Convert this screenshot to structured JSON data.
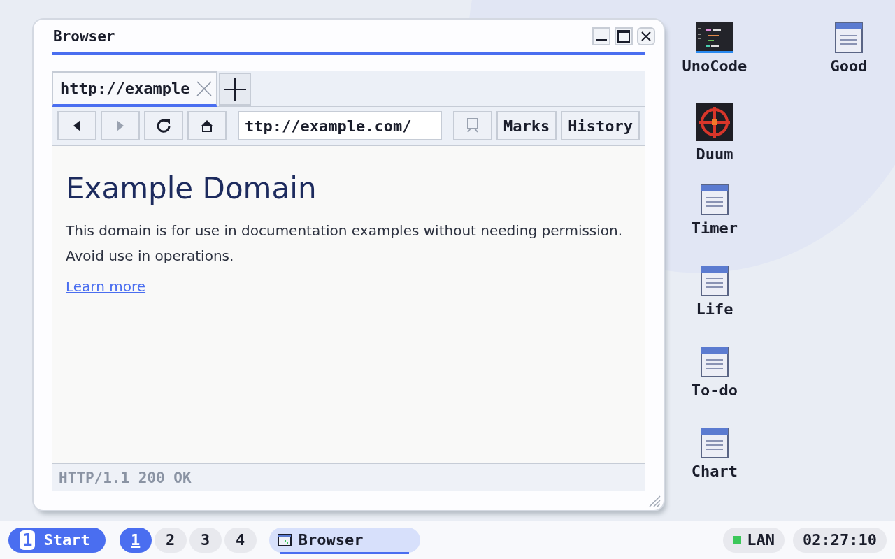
{
  "window": {
    "title": "Browser"
  },
  "tabs": [
    {
      "label": "http://example",
      "selected": true
    }
  ],
  "toolbar": {
    "nav": [
      {
        "kind": "back",
        "disabled": false
      },
      {
        "kind": "forward",
        "disabled": true
      },
      {
        "kind": "reload",
        "disabled": false
      },
      {
        "kind": "home",
        "disabled": false
      }
    ],
    "address": "ttp://example.com/",
    "bookmark_disabled": true,
    "buttons": [
      "Marks",
      "History"
    ]
  },
  "page": {
    "heading": "Example Domain",
    "paragraph": "This domain is for use in documentation examples without needing permission. Avoid use in operations.",
    "link": "Learn more"
  },
  "status_bar": "HTTP/1.1 200 OK",
  "desktop_icons": [
    {
      "label": "UnoCode",
      "kind": "code"
    },
    {
      "label": "Duum",
      "kind": "target"
    },
    {
      "label": "Timer",
      "kind": "doc"
    },
    {
      "label": "Life",
      "kind": "doc"
    },
    {
      "label": "To-do",
      "kind": "doc"
    },
    {
      "label": "Chart",
      "kind": "doc"
    },
    {
      "label": "Good",
      "kind": "doc"
    }
  ],
  "taskbar": {
    "start": {
      "badge": "1",
      "label": "Start"
    },
    "workspaces": [
      {
        "label": "1",
        "selected": true
      },
      {
        "label": "2",
        "selected": false
      },
      {
        "label": "3",
        "selected": false
      },
      {
        "label": "4",
        "selected": false
      }
    ],
    "tasks": [
      {
        "label": "Browser",
        "selected": true
      }
    ],
    "network": {
      "label": "LAN",
      "color": "#3cc85a"
    },
    "clock": "02:27:10"
  }
}
